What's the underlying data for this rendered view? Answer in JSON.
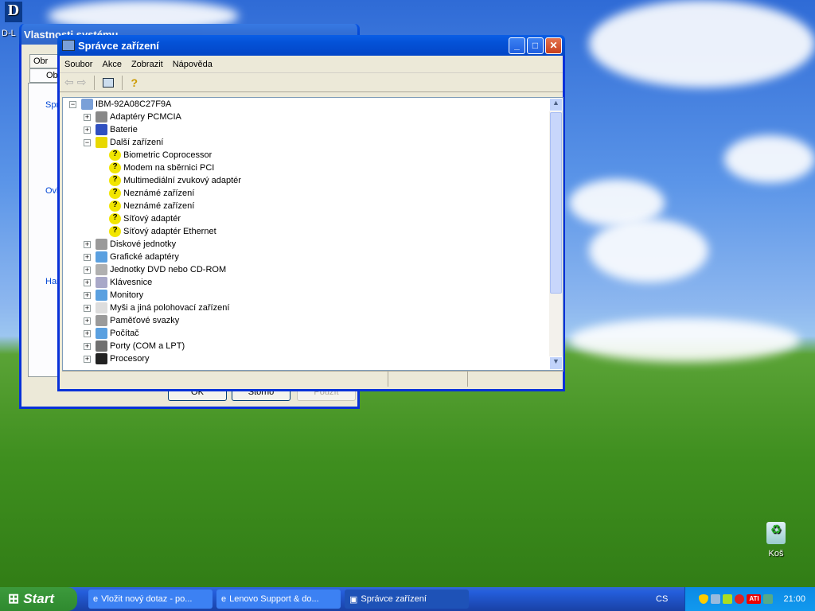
{
  "desktop": {
    "dlink_icon_label": "D-L",
    "recycle_bin_label": "Koš"
  },
  "back_window": {
    "title": "Vlastnosti systému",
    "tabs": [
      "Obr",
      "Ob"
    ],
    "groups": [
      "Spr",
      "Ovl",
      "Har"
    ],
    "buttons": {
      "ok": "OK",
      "cancel": "Storno",
      "apply": "Použít"
    }
  },
  "window": {
    "title": "Správce zařízení",
    "menu": [
      "Soubor",
      "Akce",
      "Zobrazit",
      "Nápověda"
    ],
    "tree": {
      "root": "IBM-92A08C27F9A",
      "items": [
        {
          "label": "Adaptéry PCMCIA",
          "expanded": false,
          "icon": "pcmcia-icon",
          "color": "#888888"
        },
        {
          "label": "Baterie",
          "expanded": false,
          "icon": "battery-icon",
          "color": "#3050c0"
        },
        {
          "label": "Další zařízení",
          "expanded": true,
          "icon": "unknown-device-icon",
          "color": "#e8d800",
          "children": [
            "Biometric Coprocessor",
            "Modem na sběrnici PCI",
            "Multimediální zvukový adaptér",
            "Neznámé zařízení",
            "Neznámé zařízení",
            "Síťový adaptér",
            "Síťový adaptér Ethernet"
          ]
        },
        {
          "label": "Diskové jednotky",
          "expanded": false,
          "icon": "disk-icon",
          "color": "#9a9a9a"
        },
        {
          "label": "Grafické adaptéry",
          "expanded": false,
          "icon": "display-adapter-icon",
          "color": "#5aa0e0"
        },
        {
          "label": "Jednotky DVD nebo CD-ROM",
          "expanded": false,
          "icon": "cdrom-icon",
          "color": "#b0b0b0"
        },
        {
          "label": "Klávesnice",
          "expanded": false,
          "icon": "keyboard-icon",
          "color": "#a8a8c8"
        },
        {
          "label": "Monitory",
          "expanded": false,
          "icon": "monitor-icon",
          "color": "#5aa0e0"
        },
        {
          "label": "Myši a jiná polohovací zařízení",
          "expanded": false,
          "icon": "mouse-icon",
          "color": "#dddddd"
        },
        {
          "label": "Paměťové svazky",
          "expanded": false,
          "icon": "storage-icon",
          "color": "#9a9a9a"
        },
        {
          "label": "Počítač",
          "expanded": false,
          "icon": "computer-icon",
          "color": "#5aa0e0"
        },
        {
          "label": "Porty (COM a LPT)",
          "expanded": false,
          "icon": "port-icon",
          "color": "#707070"
        },
        {
          "label": "Procesory",
          "expanded": false,
          "icon": "processor-icon",
          "color": "#222222"
        }
      ]
    }
  },
  "taskbar": {
    "start": "Start",
    "tasks": [
      "Vložit nový dotaz - po...",
      "Lenovo Support & do...",
      "Správce zařízení"
    ],
    "language": "CS",
    "clock": "21:00"
  }
}
